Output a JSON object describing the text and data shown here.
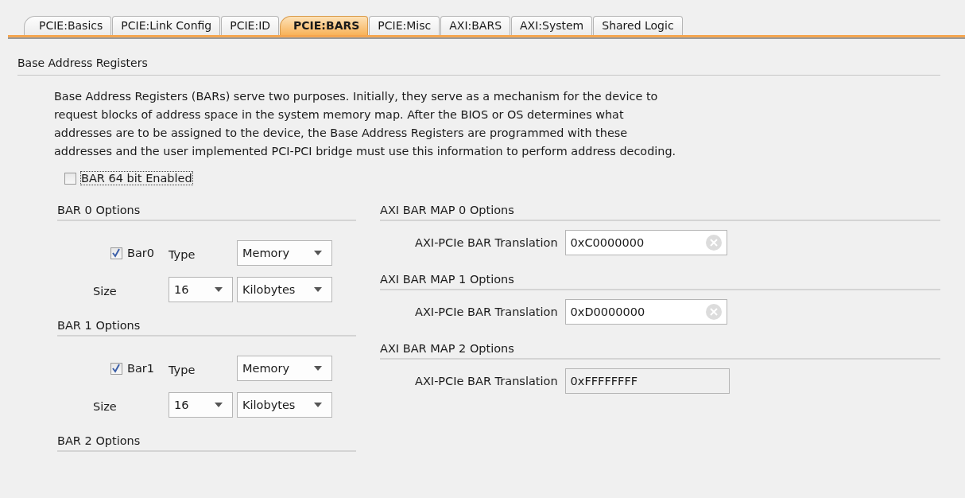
{
  "tabs": [
    {
      "label": "PCIE:Basics",
      "selected": false
    },
    {
      "label": "PCIE:Link Config",
      "selected": false
    },
    {
      "label": "PCIE:ID",
      "selected": false
    },
    {
      "label": "PCIE:BARS",
      "selected": true
    },
    {
      "label": "PCIE:Misc",
      "selected": false
    },
    {
      "label": "AXI:BARS",
      "selected": false
    },
    {
      "label": "AXI:System",
      "selected": false
    },
    {
      "label": "Shared Logic",
      "selected": false
    }
  ],
  "section_title": "Base Address Registers",
  "description": "Base Address Registers (BARs) serve two purposes. Initially, they serve as a mechanism for the device to request blocks of address space in the system memory map. After the BIOS or OS determines what addresses are to be assigned to the device, the Base Address Registers are programmed with these addresses and the user implemented PCI-PCI bridge must use this information to perform address decoding.",
  "bar64": {
    "label": "BAR 64 bit Enabled",
    "checked": false
  },
  "bar_sections": [
    {
      "title": "BAR 0 Options",
      "enable": {
        "label": "Bar0",
        "checked": true
      },
      "type_label": "Type",
      "type_value": "Memory",
      "size_label": "Size",
      "size_value": "16",
      "size_unit": "Kilobytes"
    },
    {
      "title": "BAR 1 Options",
      "enable": {
        "label": "Bar1",
        "checked": true
      },
      "type_label": "Type",
      "type_value": "Memory",
      "size_label": "Size",
      "size_value": "16",
      "size_unit": "Kilobytes"
    },
    {
      "title": "BAR 2 Options"
    }
  ],
  "axi_bar_maps": [
    {
      "title": "AXI BAR MAP 0 Options",
      "label": "AXI-PCIe BAR Translation",
      "value": "0xC0000000",
      "disabled": false
    },
    {
      "title": "AXI BAR MAP 1 Options",
      "label": "AXI-PCIe BAR Translation",
      "value": "0xD0000000",
      "disabled": false
    },
    {
      "title": "AXI BAR MAP 2 Options",
      "label": "AXI-PCIe BAR Translation",
      "value": "0xFFFFFFFF",
      "disabled": true
    }
  ]
}
